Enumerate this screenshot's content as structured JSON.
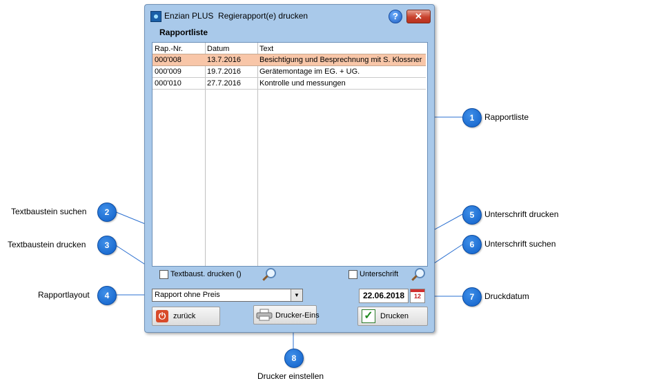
{
  "window": {
    "title": "Enzian PLUS  Regierapport(e) drucken",
    "help_label": "?",
    "close_label": "✕",
    "section_label": "Rapportliste"
  },
  "list": {
    "columns": [
      "Rap.-Nr.",
      "Datum",
      "Text"
    ],
    "rows": [
      {
        "nr": "000'008",
        "datum": "13.7.2016",
        "text": "Besichtigung und Besprechnung mit S. Klossner",
        "selected": true
      },
      {
        "nr": "000'009",
        "datum": "19.7.2016",
        "text": "Gerätemontage im EG. + UG.",
        "selected": false
      },
      {
        "nr": "000'010",
        "datum": "27.7.2016",
        "text": "Kontrolle und messungen",
        "selected": false
      }
    ]
  },
  "options": {
    "textbaustein_label": "Textbaust. drucken ()",
    "unterschrift_label": "Unterschrift",
    "layout_value": "Rapport ohne Preis",
    "druckdatum": "22.06.2018",
    "calendar_day": "12"
  },
  "buttons": {
    "zurueck": "zurück",
    "drucker_eins": "Drucker-Eins",
    "drucken": "Drucken"
  },
  "callouts": [
    {
      "num": "1",
      "label": "Rapportliste"
    },
    {
      "num": "2",
      "label": "Textbaustein suchen"
    },
    {
      "num": "3",
      "label": "Textbaustein drucken"
    },
    {
      "num": "4",
      "label": "Rapportlayout"
    },
    {
      "num": "5",
      "label": "Unterschrift drucken"
    },
    {
      "num": "6",
      "label": "Unterschrift suchen"
    },
    {
      "num": "7",
      "label": "Druckdatum"
    },
    {
      "num": "8",
      "label": "Drucker einstellen"
    }
  ],
  "colors": {
    "window_bg": "#a9c9ea",
    "selected_row": "#f8c6a8",
    "callout_blue": "#0f5fc8"
  }
}
